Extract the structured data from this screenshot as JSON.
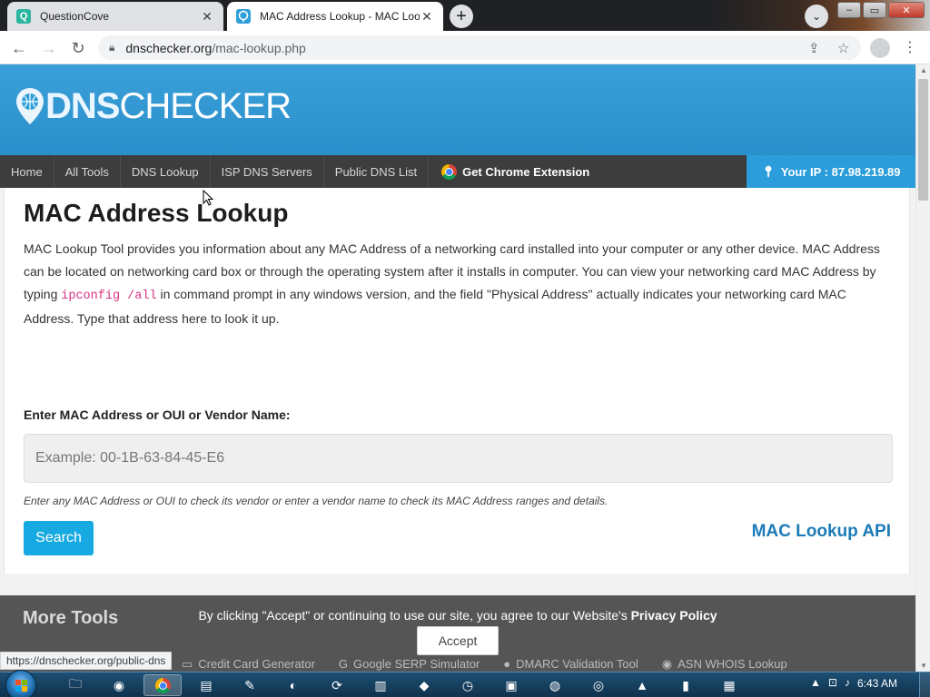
{
  "browser": {
    "tabs": [
      {
        "title": "QuestionCove",
        "favicon": "Q",
        "active": false
      },
      {
        "title": "MAC Address Lookup - MAC Loo",
        "favicon": "dnschecker-icon",
        "active": true
      }
    ],
    "url_host": "dnschecker.org",
    "url_path": "/mac-lookup.php",
    "status_link": "https://dnschecker.org/public-dns"
  },
  "site": {
    "logo_dns": "DNS",
    "logo_checker": "CHECKER",
    "nav": [
      "Home",
      "All Tools",
      "DNS Lookup",
      "ISP DNS Servers",
      "Public DNS List"
    ],
    "extension_label": "Get Chrome Extension",
    "ip_label": "Your IP : 87.98.219.89"
  },
  "main": {
    "title": "MAC Address Lookup",
    "intro_1": "MAC Lookup Tool provides you information about any MAC Address of a networking card installed into your computer or any other device. MAC Address can be located on networking card box or through the operating system after it installs in computer. You can view your networking card MAC Address by typing ",
    "intro_code": "ipconfig /all",
    "intro_2": " in command prompt in any windows version, and the field \"Physical Address\" actually indicates your networking card MAC Address. Type that address here to look it up.",
    "field_label": "Enter MAC Address or OUI or Vendor Name:",
    "input_placeholder": "Example: 00-1B-63-84-45-E6",
    "input_value": "",
    "helper_text": "Enter any MAC Address or OUI to check its vendor or enter a vendor name to check its MAC Address ranges and details.",
    "search_label": "Search",
    "api_link": "MAC Lookup API"
  },
  "more_tools": {
    "title": "More Tools",
    "items": [
      "Credit Card Generator",
      "Google SERP Simulator",
      "DMARC Validation Tool",
      "ASN WHOIS Lookup"
    ]
  },
  "cookie": {
    "text": "By clicking \"Accept\" or continuing to use our site, you agree to our Website's ",
    "link": "Privacy Policy",
    "accept_label": "Accept"
  },
  "taskbar": {
    "time": "6:43 AM"
  },
  "colors": {
    "header_blue": "#2b8fcb",
    "nav_dark": "#3d3d3d",
    "ip_blue": "#2b9ddb",
    "button_blue": "#17a9e1",
    "api_link": "#1b7bb7",
    "code_pink": "#d63384"
  }
}
